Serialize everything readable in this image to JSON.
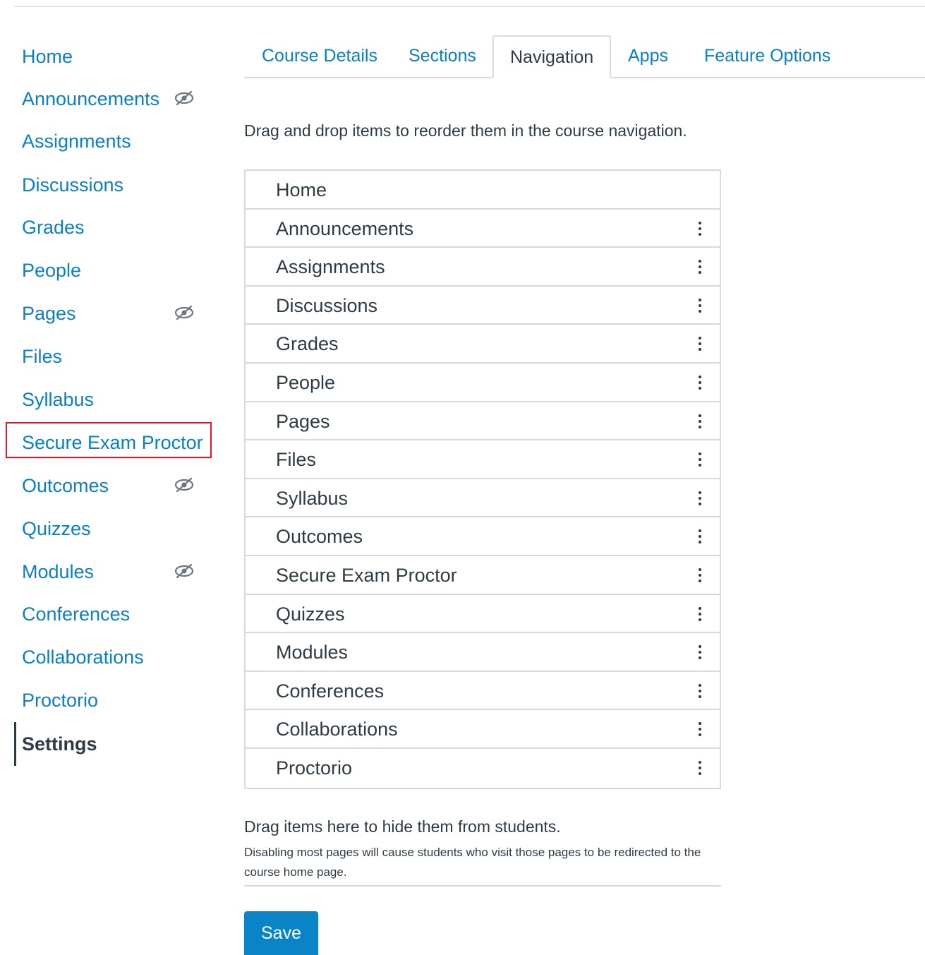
{
  "course_nav": {
    "items": [
      {
        "label": "Home",
        "hidden": false
      },
      {
        "label": "Announcements",
        "hidden": true
      },
      {
        "label": "Assignments",
        "hidden": false
      },
      {
        "label": "Discussions",
        "hidden": false
      },
      {
        "label": "Grades",
        "hidden": false
      },
      {
        "label": "People",
        "hidden": false
      },
      {
        "label": "Pages",
        "hidden": true
      },
      {
        "label": "Files",
        "hidden": false
      },
      {
        "label": "Syllabus",
        "hidden": false
      },
      {
        "label": "Secure Exam Proctor",
        "hidden": false,
        "highlighted": true
      },
      {
        "label": "Outcomes",
        "hidden": true
      },
      {
        "label": "Quizzes",
        "hidden": false
      },
      {
        "label": "Modules",
        "hidden": true
      },
      {
        "label": "Conferences",
        "hidden": false
      },
      {
        "label": "Collaborations",
        "hidden": false
      },
      {
        "label": "Proctorio",
        "hidden": false
      },
      {
        "label": "Settings",
        "hidden": false,
        "active": true
      }
    ],
    "link_color": "#0a7fc6",
    "highlight_color": "#e0181f"
  },
  "tabs": [
    {
      "label": "Course Details",
      "active": false
    },
    {
      "label": "Sections",
      "active": false
    },
    {
      "label": "Navigation",
      "active": true
    },
    {
      "label": "Apps",
      "active": false
    },
    {
      "label": "Feature Options",
      "active": false
    }
  ],
  "navigation": {
    "instructions": "Drag and drop items to reorder them in the course navigation.",
    "enabled_items": [
      {
        "label": "Home",
        "has_menu": false
      },
      {
        "label": "Announcements",
        "has_menu": true
      },
      {
        "label": "Assignments",
        "has_menu": true
      },
      {
        "label": "Discussions",
        "has_menu": true
      },
      {
        "label": "Grades",
        "has_menu": true
      },
      {
        "label": "People",
        "has_menu": true
      },
      {
        "label": "Pages",
        "has_menu": true
      },
      {
        "label": "Files",
        "has_menu": true
      },
      {
        "label": "Syllabus",
        "has_menu": true
      },
      {
        "label": "Outcomes",
        "has_menu": true
      },
      {
        "label": "Secure Exam Proctor",
        "has_menu": true
      },
      {
        "label": "Quizzes",
        "has_menu": true
      },
      {
        "label": "Modules",
        "has_menu": true
      },
      {
        "label": "Conferences",
        "has_menu": true
      },
      {
        "label": "Collaborations",
        "has_menu": true
      },
      {
        "label": "Proctorio",
        "has_menu": true
      }
    ],
    "hidden_section": {
      "title": "Drag items here to hide them from students.",
      "note": "Disabling most pages will cause students who visit those pages to be redirected to the course home page."
    },
    "save_label": "Save",
    "save_color": "#0a84c6"
  },
  "icons": {
    "hidden": "eye-slash-icon",
    "row_menu": "kebab-menu-icon"
  }
}
